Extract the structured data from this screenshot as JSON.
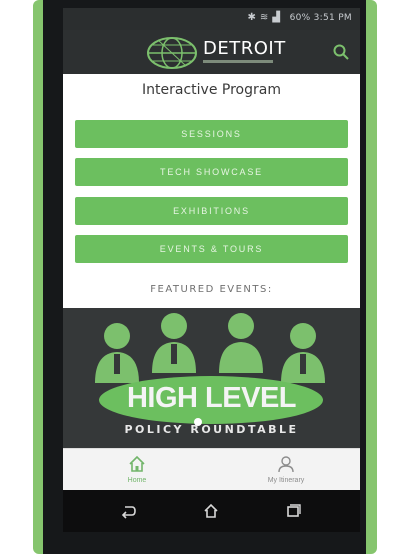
{
  "status_bar": {
    "battery_time": "60% 3:51 PM"
  },
  "app_bar": {
    "logo_text": "DETROIT"
  },
  "main": {
    "section_title": "Interactive Program",
    "program_buttons": [
      {
        "label": "SESSIONS"
      },
      {
        "label": "TECH SHOWCASE"
      },
      {
        "label": "EXHIBITIONS"
      },
      {
        "label": "EVENTS & TOURS"
      }
    ],
    "featured_heading": "FEATURED EVENTS:",
    "banner": {
      "title": "HIGH LEVEL",
      "subtitle": "POLICY ROUNDTABLE"
    }
  },
  "tab_bar": {
    "tabs": [
      {
        "label": "Home",
        "icon": "home-icon"
      },
      {
        "label": "My Itinerary",
        "icon": "person-icon"
      }
    ]
  },
  "colors": {
    "accent": "#6cbf5f",
    "dark": "#2d3031",
    "phone_shell": "#86c56e"
  }
}
